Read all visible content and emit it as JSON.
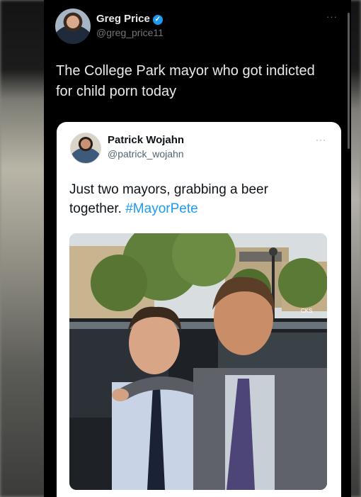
{
  "tweet": {
    "author_name": "Greg Price",
    "author_handle": "@greg_price11",
    "more_label": "···",
    "text": "The College Park mayor who got indicted for child porn today"
  },
  "quoted_tweet": {
    "author_name": "Patrick Wojahn",
    "author_handle": "@patrick_wojahn",
    "more_label": "···",
    "text": "Just two mayors, grabbing a beer together.",
    "hashtag": "#MayorPete"
  },
  "photo_sign_text": "CKS",
  "icons": {
    "verified": "verified-badge-icon",
    "more": "more-options-icon"
  },
  "colors": {
    "background": "#000000",
    "accent": "#1d9bf0",
    "secondary_text": "#71767b"
  }
}
